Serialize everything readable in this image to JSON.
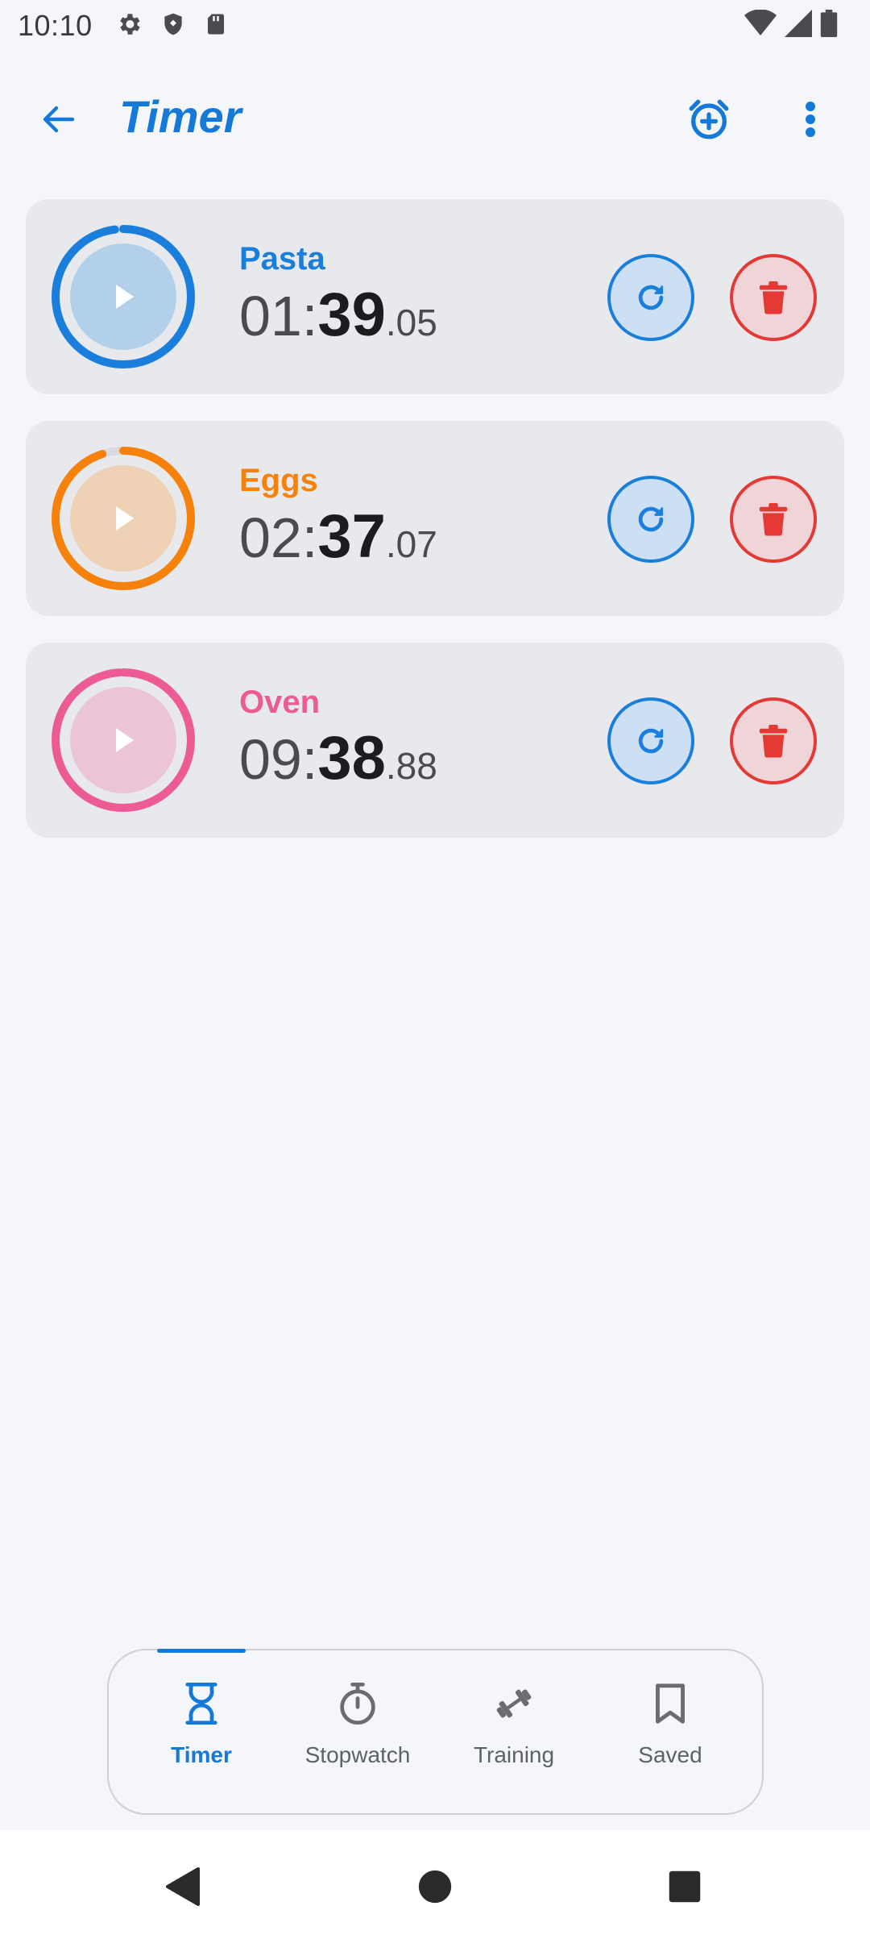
{
  "status_bar": {
    "time": "10:10",
    "left_icons": [
      "gear-icon",
      "shield-icon",
      "sd-card-icon"
    ],
    "right_icons": [
      "wifi-icon",
      "signal-icon",
      "battery-icon"
    ]
  },
  "app_bar": {
    "title": "Timer",
    "back_icon": "arrow-back-icon",
    "add_alarm_icon": "alarm-add-icon",
    "more_icon": "more-vert-icon",
    "accent_color": "#1479d8"
  },
  "timers": [
    {
      "name": "Pasta",
      "minutes": "01",
      "seconds": "39",
      "hundredths": "05",
      "color": "#1a7fdc",
      "play_fill": "#b3d0ea",
      "progress": 0.98
    },
    {
      "name": "Eggs",
      "minutes": "02",
      "seconds": "37",
      "hundredths": "07",
      "color": "#f6820c",
      "play_fill": "#efd2b5",
      "progress": 0.95
    },
    {
      "name": "Oven",
      "minutes": "09",
      "seconds": "38",
      "hundredths": "88",
      "color": "#ec5b93",
      "play_fill": "#ecc4d7",
      "progress": 0.99
    }
  ],
  "bottom_nav": {
    "items": [
      {
        "label": "Timer",
        "icon": "hourglass-icon",
        "active": true
      },
      {
        "label": "Stopwatch",
        "icon": "stopwatch-icon",
        "active": false
      },
      {
        "label": "Training",
        "icon": "dumbbell-icon",
        "active": false
      },
      {
        "label": "Saved",
        "icon": "bookmark-icon",
        "active": false
      }
    ]
  },
  "system_nav": [
    "back-triangle-icon",
    "home-circle-icon",
    "recents-square-icon"
  ]
}
